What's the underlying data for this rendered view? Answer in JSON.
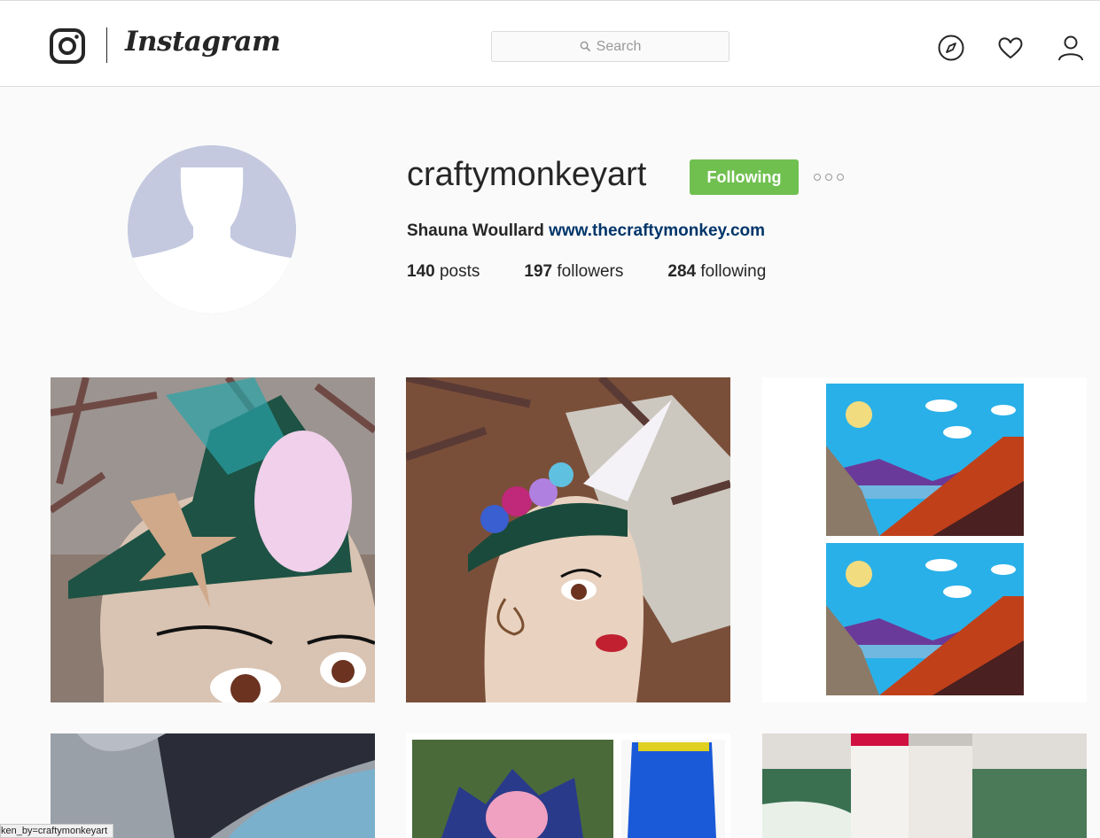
{
  "header": {
    "wordmark": "Instagram",
    "search_placeholder": "Search",
    "icons": [
      "instagram-camera-icon",
      "compass-icon",
      "heart-icon",
      "person-icon"
    ]
  },
  "profile": {
    "username": "craftymonkeyart",
    "follow_button_label": "Following",
    "full_name": "Shauna Woullard",
    "website": "www.thecraftymonkey.com",
    "stats": {
      "posts_count": "140",
      "posts_label": "posts",
      "followers_count": "197",
      "followers_label": "followers",
      "following_count": "284",
      "following_label": "following"
    }
  },
  "colors": {
    "following_green": "#70c050",
    "link_blue": "#003569",
    "avatar_gray": "#c4c9df"
  },
  "status_bar": {
    "text": "ken_by=craftymonkeyart"
  }
}
